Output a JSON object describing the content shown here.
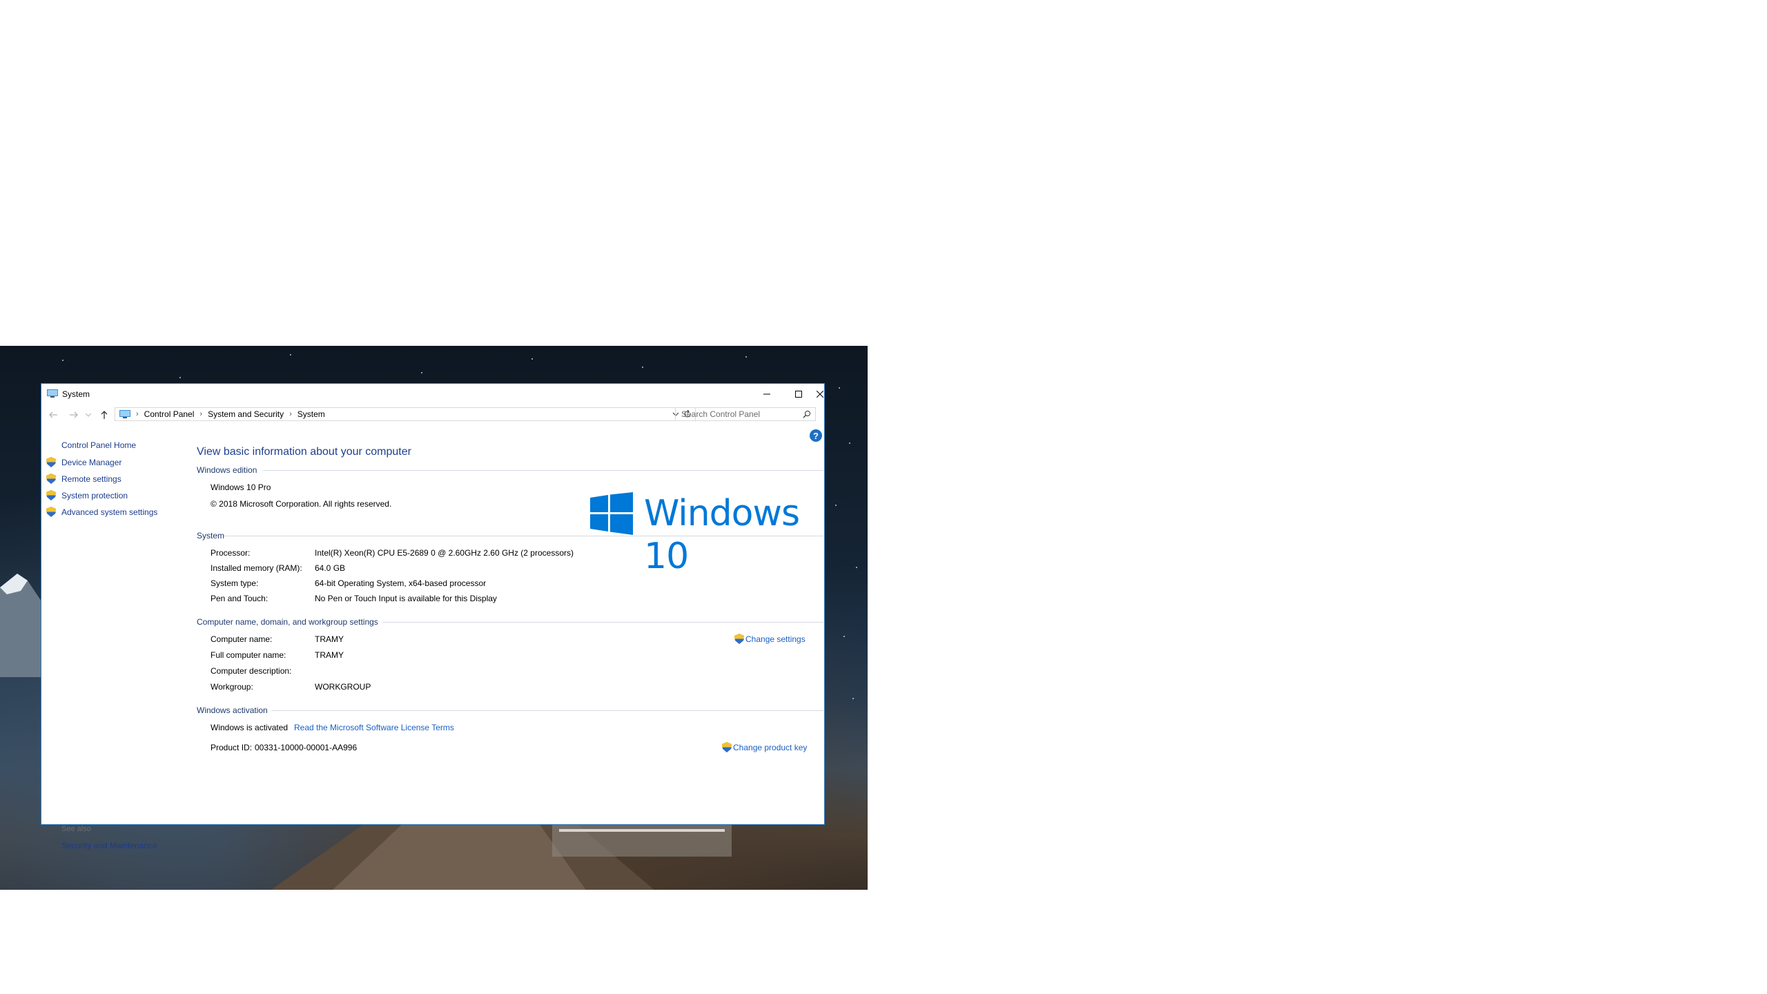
{
  "window": {
    "title": "System"
  },
  "address": {
    "crumbs": [
      "Control Panel",
      "System and Security",
      "System"
    ],
    "search_placeholder": "Search Control Panel"
  },
  "help": {
    "glyph": "?"
  },
  "leftnav": {
    "home": "Control Panel Home",
    "items": [
      "Device Manager",
      "Remote settings",
      "System protection",
      "Advanced system settings"
    ],
    "see_also": "See also",
    "see_also_items": [
      "Security and Maintenance"
    ]
  },
  "main": {
    "heading": "View basic information about your computer",
    "edition": {
      "label": "Windows edition",
      "name": "Windows 10 Pro",
      "copyright": "© 2018 Microsoft Corporation. All rights reserved.",
      "logo_text": "Windows 10"
    },
    "system": {
      "label": "System",
      "rows": [
        {
          "label": "Processor:",
          "value": "Intel(R) Xeon(R) CPU E5-2689 0 @ 2.60GHz   2.60 GHz  (2 processors)"
        },
        {
          "label": "Installed memory (RAM):",
          "value": "64.0 GB"
        },
        {
          "label": "System type:",
          "value": "64-bit Operating System, x64-based processor"
        },
        {
          "label": "Pen and Touch:",
          "value": "No Pen or Touch Input is available for this Display"
        }
      ]
    },
    "computer": {
      "label": "Computer name, domain, and workgroup settings",
      "change_settings": "Change settings",
      "rows": [
        {
          "label": "Computer name:",
          "value": "TRAMY"
        },
        {
          "label": "Full computer name:",
          "value": "TRAMY"
        },
        {
          "label": "Computer description:",
          "value": ""
        },
        {
          "label": "Workgroup:",
          "value": "WORKGROUP"
        }
      ]
    },
    "activation": {
      "label": "Windows activation",
      "status": "Windows is activated",
      "license_link": "Read the Microsoft Software License Terms",
      "product_id_label": "Product ID:",
      "product_id": "00331-10000-00001-AA996",
      "change_key": "Change product key"
    }
  },
  "colors": {
    "accent": "#0078d7",
    "link": "#1a5fc4",
    "nav_link": "#1a3c8c",
    "heading": "#1e3f8f"
  }
}
